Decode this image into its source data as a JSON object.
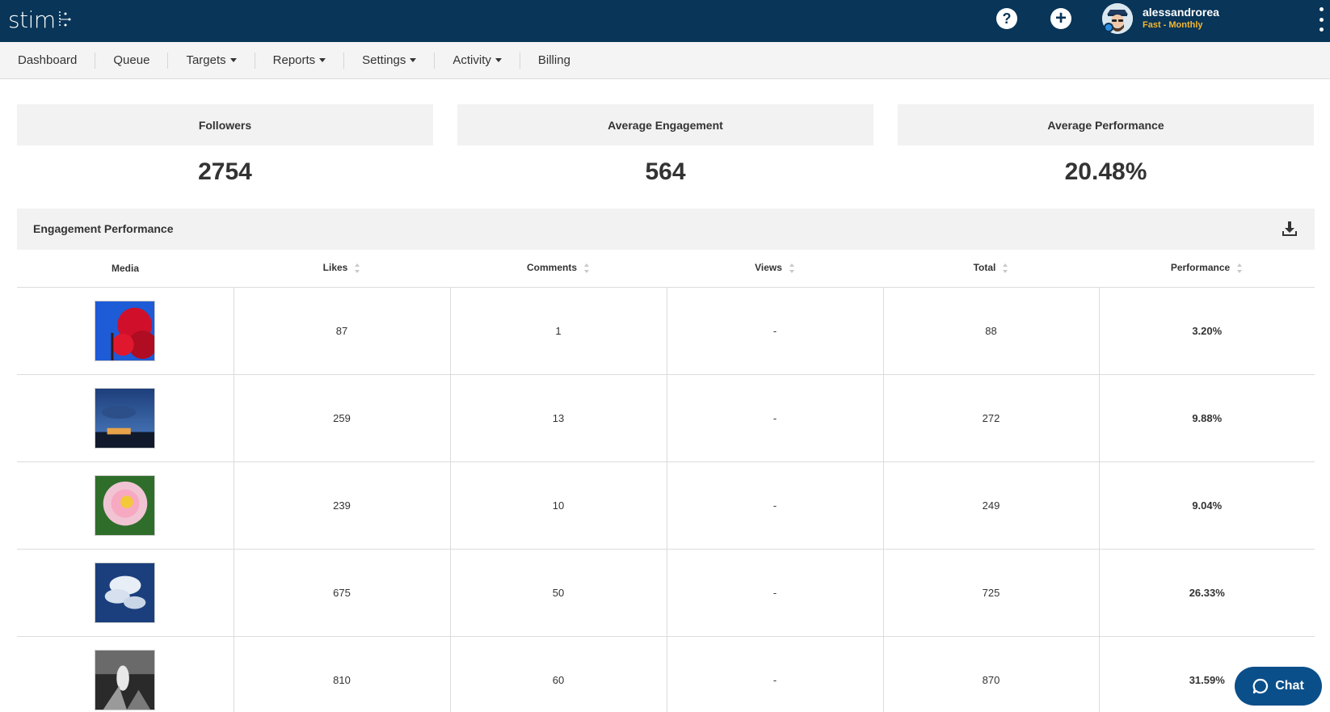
{
  "header": {
    "logo_text": "stim",
    "user_name": "alessandrorea",
    "user_plan": "Fast - Monthly",
    "icons": [
      "help-icon",
      "add-icon",
      "kebab-icon"
    ]
  },
  "nav": {
    "items": [
      {
        "label": "Dashboard",
        "dropdown": false
      },
      {
        "label": "Queue",
        "dropdown": false
      },
      {
        "label": "Targets",
        "dropdown": true
      },
      {
        "label": "Reports",
        "dropdown": true
      },
      {
        "label": "Settings",
        "dropdown": true
      },
      {
        "label": "Activity",
        "dropdown": true
      },
      {
        "label": "Billing",
        "dropdown": false
      }
    ]
  },
  "stats": [
    {
      "label": "Followers",
      "value": "2754"
    },
    {
      "label": "Average Engagement",
      "value": "564"
    },
    {
      "label": "Average Performance",
      "value": "20.48%"
    }
  ],
  "engagement": {
    "title": "Engagement Performance",
    "columns": [
      "Media",
      "Likes",
      "Comments",
      "Views",
      "Total",
      "Performance"
    ],
    "rows": [
      {
        "thumb": "red-tree",
        "likes": "87",
        "comments": "1",
        "views": "-",
        "total": "88",
        "performance": "3.20%"
      },
      {
        "thumb": "night-sky",
        "likes": "259",
        "comments": "13",
        "views": "-",
        "total": "272",
        "performance": "9.88%"
      },
      {
        "thumb": "pink-flower",
        "likes": "239",
        "comments": "10",
        "views": "-",
        "total": "249",
        "performance": "9.04%"
      },
      {
        "thumb": "clouds",
        "likes": "675",
        "comments": "50",
        "views": "-",
        "total": "725",
        "performance": "26.33%"
      },
      {
        "thumb": "bw-plant",
        "likes": "810",
        "comments": "60",
        "views": "-",
        "total": "870",
        "performance": "31.59%"
      }
    ]
  },
  "chat": {
    "label": "Chat"
  },
  "colors": {
    "topbar": "#083558",
    "plan": "#f5b731",
    "chat": "#0b4f8a"
  }
}
